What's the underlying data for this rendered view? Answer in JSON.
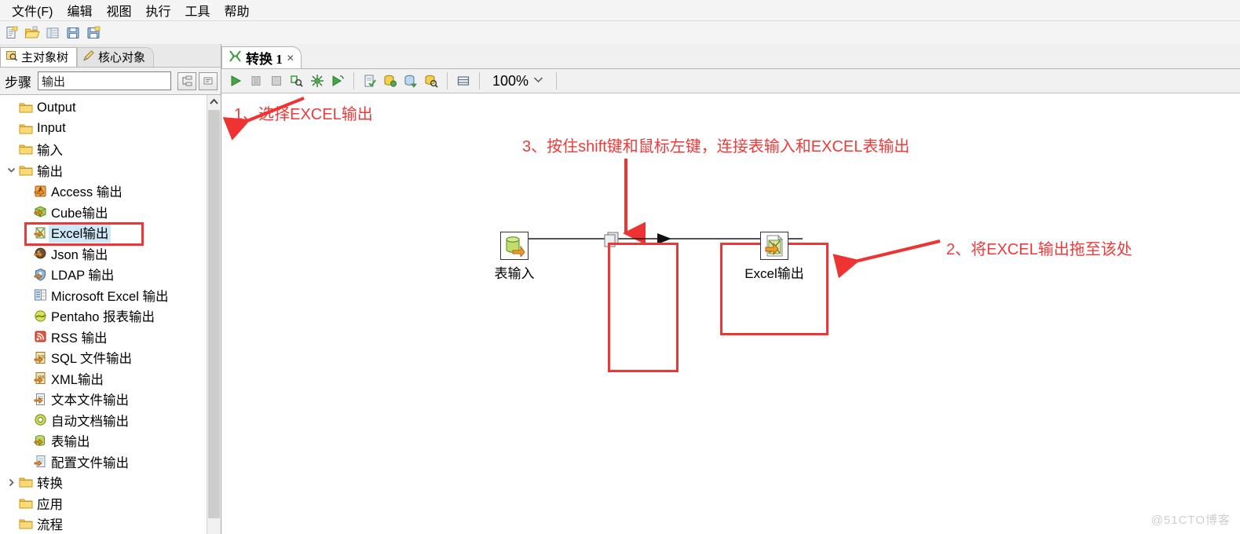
{
  "menubar": {
    "items": [
      {
        "label": "文件(F)",
        "name": "menu-file"
      },
      {
        "label": "编辑",
        "name": "menu-edit"
      },
      {
        "label": "视图",
        "name": "menu-view"
      },
      {
        "label": "执行",
        "name": "menu-run"
      },
      {
        "label": "工具",
        "name": "menu-tools"
      },
      {
        "label": "帮助",
        "name": "menu-help"
      }
    ]
  },
  "toolbar": {
    "buttons": [
      {
        "icon": "new-file-icon",
        "name": "new-transformation-button"
      },
      {
        "icon": "open-folder-icon",
        "name": "open-file-button"
      },
      {
        "icon": "explorer-grid-icon",
        "name": "repository-explorer-button"
      },
      {
        "icon": "save-icon",
        "name": "save-button"
      },
      {
        "icon": "save-as-icon",
        "name": "save-as-button"
      }
    ]
  },
  "left_panel": {
    "tabs": [
      {
        "label": "主对象树",
        "icon": "tree-view-icon",
        "active": true
      },
      {
        "label": "核心对象",
        "icon": "pencil-icon",
        "active": false
      }
    ],
    "search": {
      "label": "步骤",
      "value": "输出",
      "placeholder": ""
    },
    "side_buttons": [
      {
        "icon": "expand-all-icon",
        "name": "expand-all-button"
      },
      {
        "icon": "collapse-all-icon",
        "name": "collapse-all-button"
      }
    ],
    "tree": [
      {
        "label": "Output",
        "icon": "folder-icon",
        "level": 0,
        "twisty": "",
        "selected": false
      },
      {
        "label": "Input",
        "icon": "folder-icon",
        "level": 0,
        "twisty": "",
        "selected": false
      },
      {
        "label": "输入",
        "icon": "folder-icon",
        "level": 0,
        "twisty": "",
        "selected": false
      },
      {
        "label": "输出",
        "icon": "folder-icon",
        "level": 0,
        "twisty": "expanded",
        "selected": false
      },
      {
        "label": "Access 输出",
        "icon": "access-output-icon",
        "level": 1,
        "twisty": "",
        "selected": false
      },
      {
        "label": "Cube输出",
        "icon": "cube-output-icon",
        "level": 1,
        "twisty": "",
        "selected": false
      },
      {
        "label": "Excel输出",
        "icon": "excel-output-icon",
        "level": 1,
        "twisty": "",
        "selected": true
      },
      {
        "label": "Json 输出",
        "icon": "json-output-icon",
        "level": 1,
        "twisty": "",
        "selected": false
      },
      {
        "label": "LDAP 输出",
        "icon": "ldap-output-icon",
        "level": 1,
        "twisty": "",
        "selected": false
      },
      {
        "label": "Microsoft Excel 输出",
        "icon": "ms-excel-output-icon",
        "level": 1,
        "twisty": "",
        "selected": false
      },
      {
        "label": "Pentaho 报表输出",
        "icon": "pentaho-report-output-icon",
        "level": 1,
        "twisty": "",
        "selected": false
      },
      {
        "label": "RSS 输出",
        "icon": "rss-output-icon",
        "level": 1,
        "twisty": "",
        "selected": false
      },
      {
        "label": "SQL 文件输出",
        "icon": "sql-file-output-icon",
        "level": 1,
        "twisty": "",
        "selected": false
      },
      {
        "label": "XML输出",
        "icon": "xml-output-icon",
        "level": 1,
        "twisty": "",
        "selected": false
      },
      {
        "label": "文本文件输出",
        "icon": "text-file-output-icon",
        "level": 1,
        "twisty": "",
        "selected": false
      },
      {
        "label": "自动文档输出",
        "icon": "auto-doc-output-icon",
        "level": 1,
        "twisty": "",
        "selected": false
      },
      {
        "label": "表输出",
        "icon": "table-output-icon",
        "level": 1,
        "twisty": "",
        "selected": false
      },
      {
        "label": "配置文件输出",
        "icon": "properties-output-icon",
        "level": 1,
        "twisty": "",
        "selected": false
      },
      {
        "label": "转换",
        "icon": "folder-icon",
        "level": 0,
        "twisty": "collapsed",
        "selected": false
      },
      {
        "label": "应用",
        "icon": "folder-icon",
        "level": 0,
        "twisty": "",
        "selected": false
      },
      {
        "label": "流程",
        "icon": "folder-icon",
        "level": 0,
        "twisty": "",
        "selected": false
      }
    ]
  },
  "editor": {
    "tab": {
      "title": "转换 1",
      "icon": "transformation-icon",
      "close": "✕"
    },
    "toolbar": {
      "buttons": [
        {
          "icon": "run-icon",
          "name": "run-button"
        },
        {
          "icon": "pause-icon",
          "name": "pause-button"
        },
        {
          "icon": "stop-icon",
          "name": "stop-button"
        },
        {
          "icon": "preview-icon",
          "name": "preview-button"
        },
        {
          "icon": "debug-icon",
          "name": "debug-button"
        },
        {
          "icon": "replay-icon",
          "name": "replay-button"
        },
        {
          "icon": "verify-icon",
          "name": "verify-button"
        },
        {
          "icon": "impact-icon",
          "name": "impact-analysis-button"
        },
        {
          "icon": "sql-icon",
          "name": "generate-sql-button"
        },
        {
          "icon": "inspect-icon",
          "name": "inspect-data-button"
        },
        {
          "icon": "grid-icon",
          "name": "show-grid-button"
        }
      ],
      "zoom": {
        "value": "100%",
        "chevron": "⌄"
      }
    }
  },
  "canvas": {
    "annotations": [
      {
        "id": "anno-1",
        "text": "1、选择EXCEL输出",
        "name": "annotation-step-1"
      },
      {
        "id": "anno-2",
        "text": "2、将EXCEL输出拖至该处",
        "name": "annotation-step-2"
      },
      {
        "id": "anno-3",
        "text": "3、按住shift键和鼠标左键，连接表输入和EXCEL表输出",
        "name": "annotation-step-3"
      }
    ],
    "steps": [
      {
        "label": "表输入",
        "icon": "table-input-step-icon",
        "name": "canvas-step-table-input"
      },
      {
        "label": "Excel输出",
        "icon": "excel-output-step-icon",
        "name": "canvas-step-excel-output"
      }
    ],
    "highlight_color": "#ef3535",
    "annotation_color": "#ef3a3a"
  },
  "watermark": {
    "text": "@51CTO博客"
  }
}
